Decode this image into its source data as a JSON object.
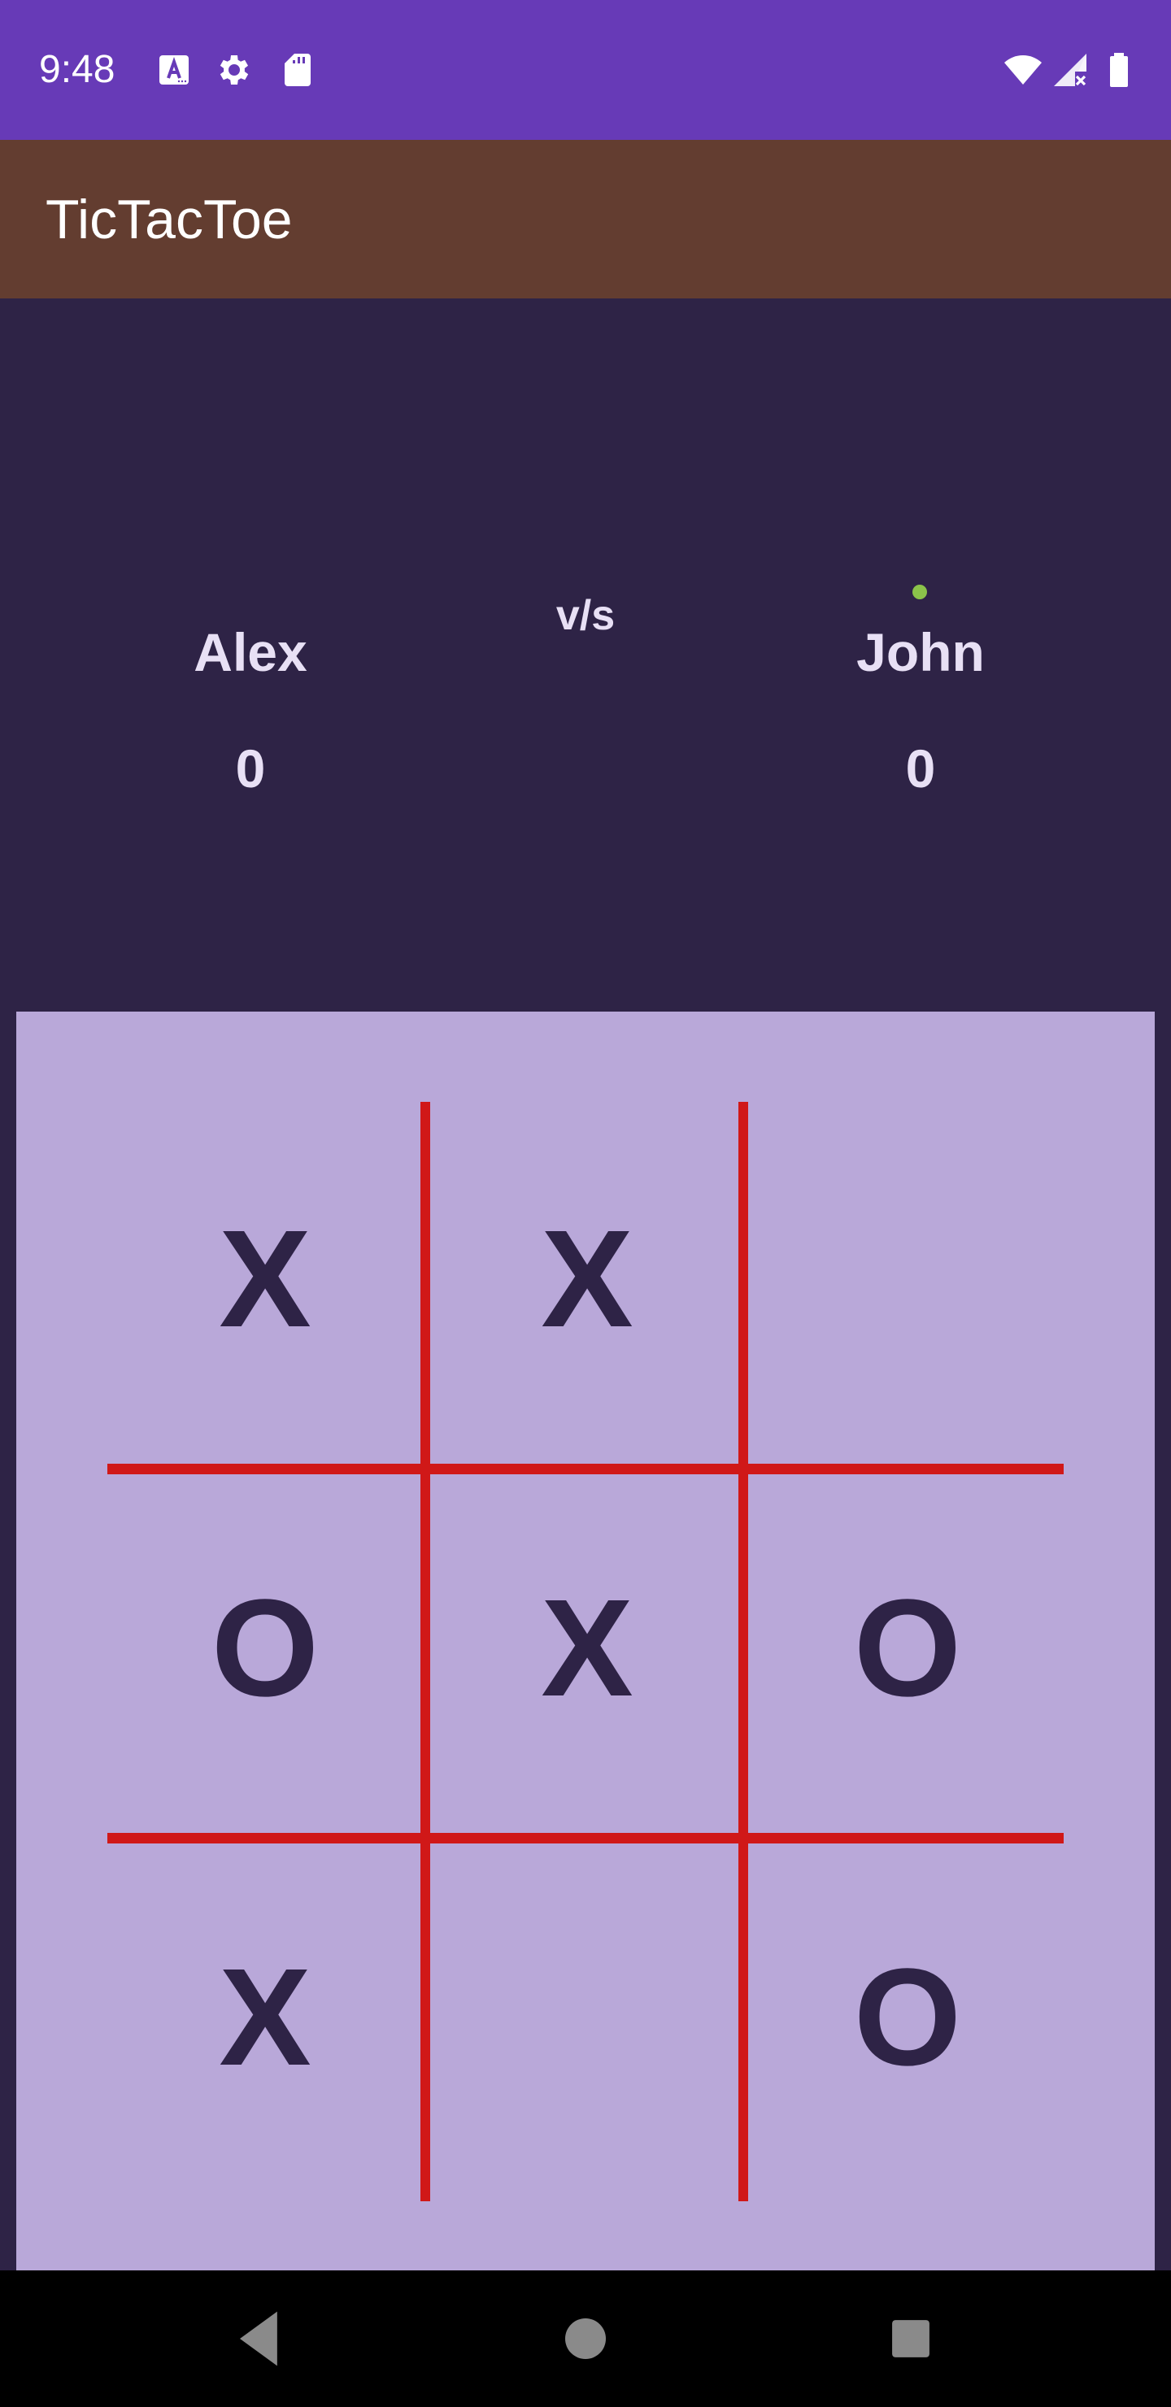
{
  "status_bar": {
    "time": "9:48",
    "icons": [
      "font-download-icon",
      "settings-gear-icon",
      "sd-card-icon",
      "wifi-icon",
      "cell-signal-off-icon",
      "battery-icon"
    ],
    "background": "#673ab7"
  },
  "app_bar": {
    "title": "TicTacToe",
    "background": "#633d30"
  },
  "players": {
    "left": {
      "name": "Alex",
      "score": "0"
    },
    "vs": "v/s",
    "right": {
      "name": "John",
      "score": "0",
      "active": true
    }
  },
  "board": {
    "cells": [
      "X",
      "X",
      "",
      "O",
      "X",
      "O",
      "X",
      "",
      "O"
    ],
    "background": "#b9a8d9",
    "line_color": "#d01818",
    "mark_color": "#2e2346"
  },
  "nav_bar": {
    "buttons": [
      "back-icon",
      "home-icon",
      "recents-icon"
    ]
  }
}
